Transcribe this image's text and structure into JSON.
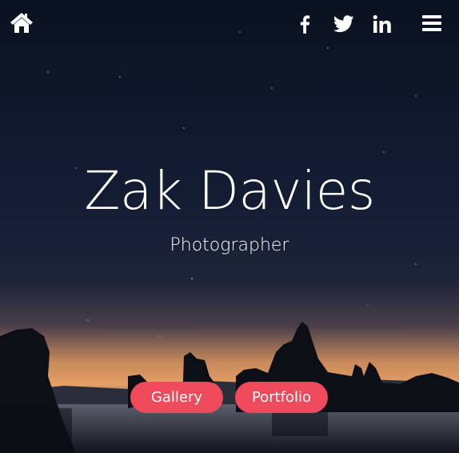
{
  "hero": {
    "name": "Zak Davies",
    "role": "Photographer"
  },
  "nav": {
    "icons": [
      "home-icon",
      "facebook-icon",
      "twitter-icon",
      "linkedin-icon",
      "menu-icon"
    ]
  },
  "buttons": {
    "gallery_label": "Gallery",
    "portfolio_label": "Portfolio"
  },
  "colors": {
    "accent": "#ef4a5c",
    "sky_top": "#0b1322",
    "horizon": "#e6a066",
    "text": "#ffffff"
  }
}
